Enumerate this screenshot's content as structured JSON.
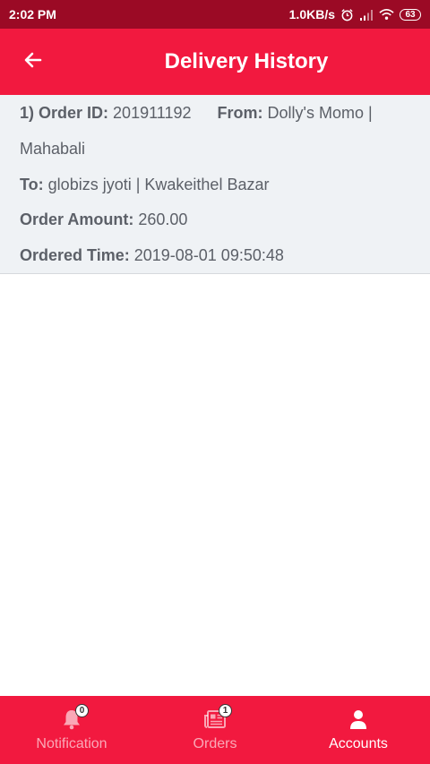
{
  "status_bar": {
    "time": "2:02 PM",
    "net_speed": "1.0KB/s",
    "battery": "63"
  },
  "app_bar": {
    "title": "Delivery History"
  },
  "history": [
    {
      "index_label": "1) Order ID:",
      "order_id": "201911192",
      "from_label": "From:",
      "from_value": "Dolly's Momo |",
      "from_value_cont": "Mahabali",
      "to_label": "To:",
      "to_value": "globizs jyoti | Kwakeithel Bazar",
      "amount_label": "Order Amount:",
      "amount_value": "260.00",
      "time_label": "Ordered Time:",
      "time_value": "2019-08-01 09:50:48"
    }
  ],
  "bottom_nav": {
    "items": [
      {
        "label": "Notification",
        "badge": "0",
        "icon": "bell-icon",
        "active": false
      },
      {
        "label": "Orders",
        "badge": "1",
        "icon": "newspaper-icon",
        "active": false
      },
      {
        "label": "Accounts",
        "badge": "",
        "icon": "person-icon",
        "active": true
      }
    ]
  },
  "colors": {
    "status_bar": "#9b0a25",
    "primary": "#f2193f",
    "card_bg": "#eff2f5",
    "text": "#5c6068"
  }
}
